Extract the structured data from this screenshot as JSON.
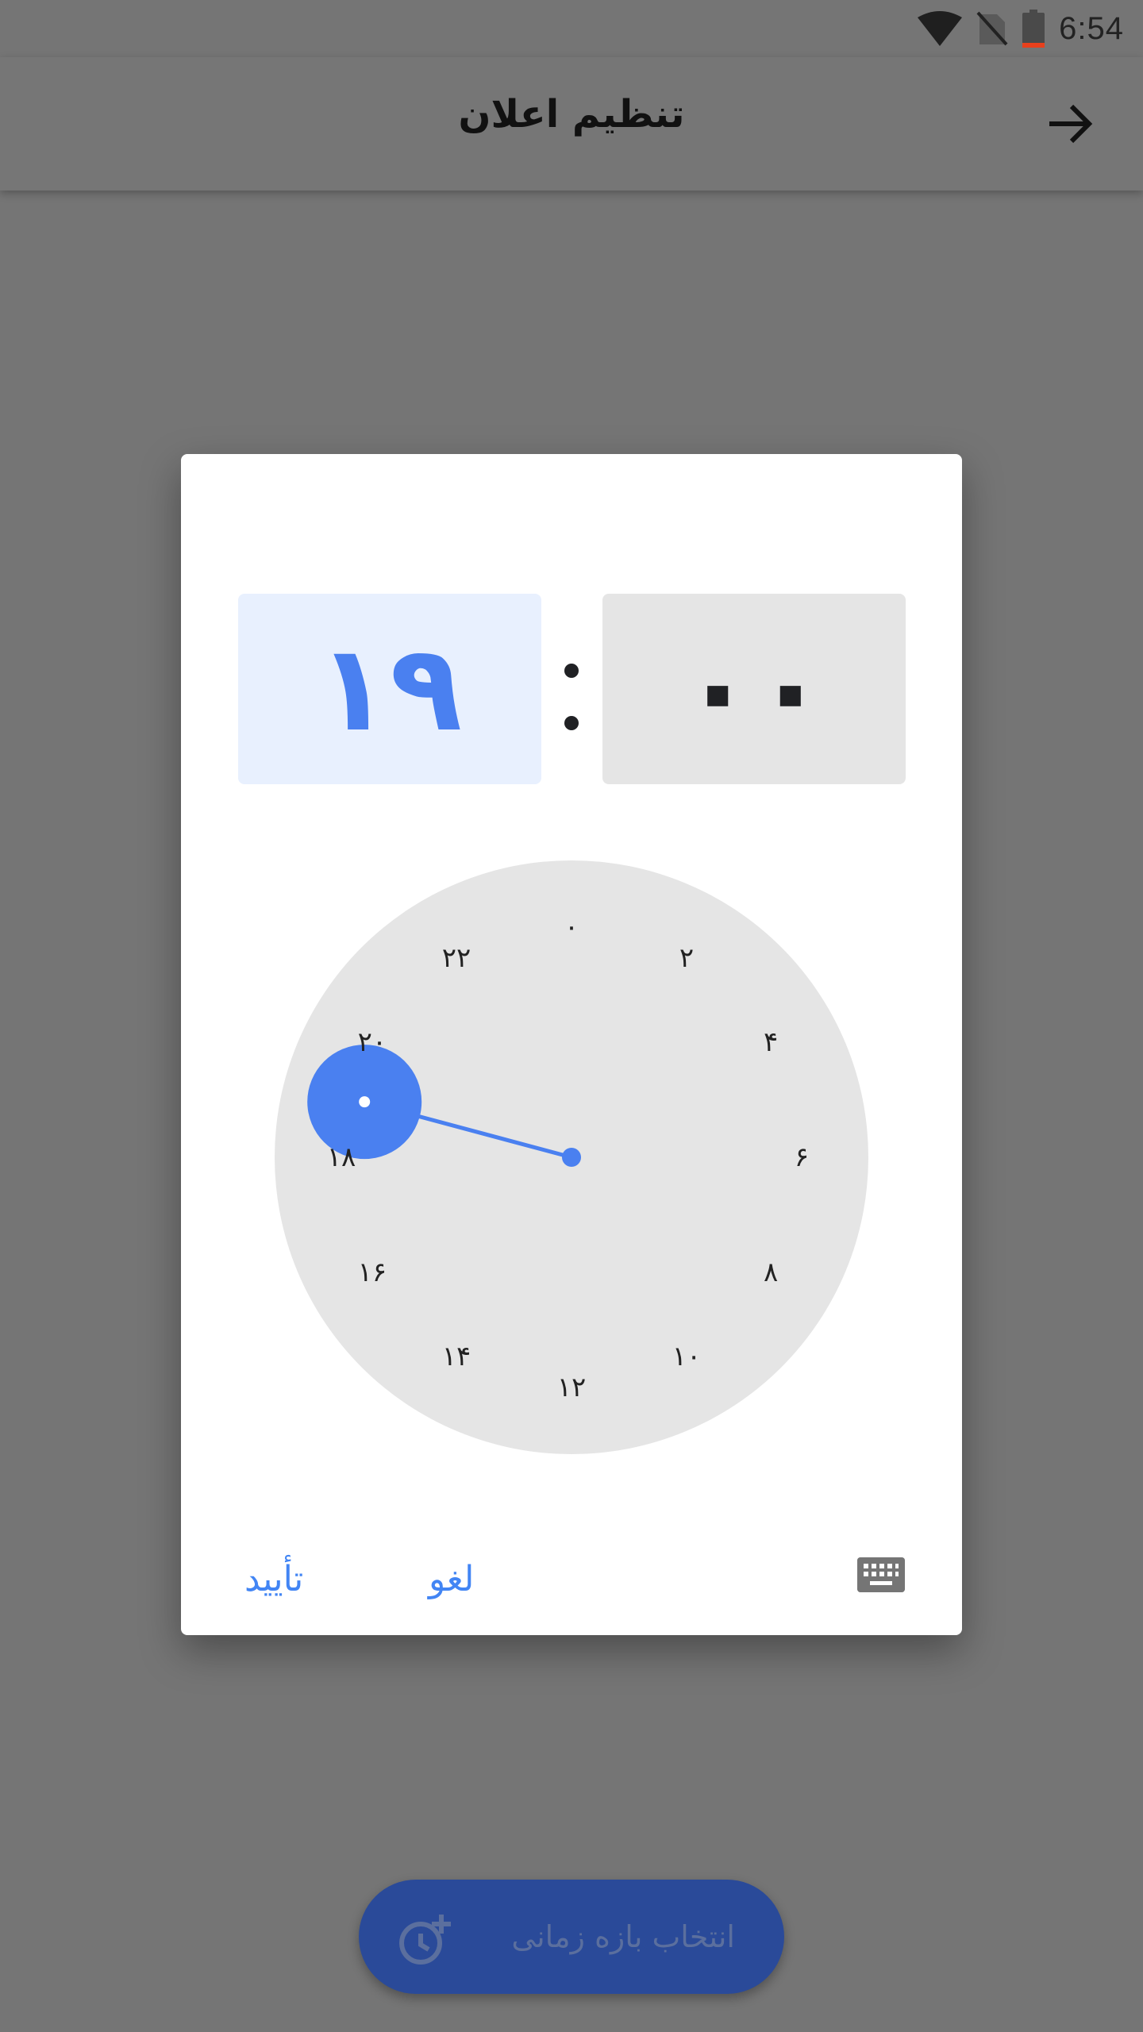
{
  "status_bar": {
    "time": "6:54",
    "icons": [
      "wifi-icon",
      "no-sim-icon",
      "battery-icon"
    ]
  },
  "app_bar": {
    "title": "تنظیم اعلان",
    "back_icon": "arrow-forward-icon"
  },
  "time_picker": {
    "hour": "۱۹",
    "minute": "۰۰",
    "clock_numbers": [
      "۰",
      "۲",
      "۴",
      "۶",
      "۸",
      "۱۰",
      "۱۲",
      "۱۴",
      "۱۶",
      "۱۸",
      "۲۰",
      "۲۲"
    ],
    "selected_hour": 19,
    "actions": {
      "confirm": "تأیید",
      "cancel": "لغو",
      "keyboard_icon": "keyboard-icon"
    }
  },
  "fab": {
    "label": "انتخاب بازه زمانی",
    "icon": "add-alarm-icon"
  },
  "colors": {
    "accent": "#4a80f0",
    "hour_bg": "#e8f0fe",
    "scrim": "#757575",
    "fab_bg": "#2a4a99"
  }
}
